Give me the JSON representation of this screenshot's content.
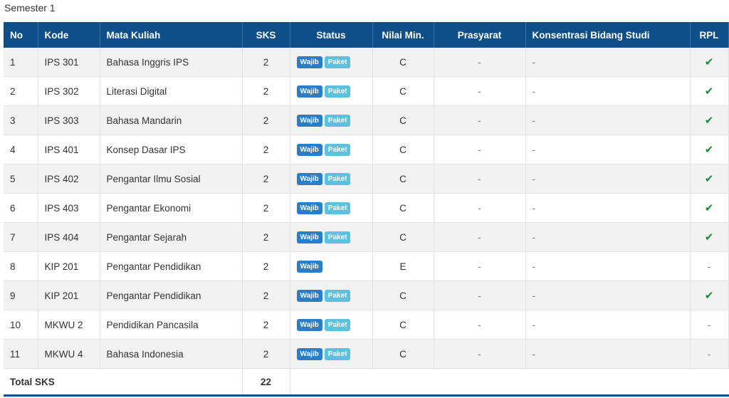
{
  "semester_title": "Semester 1",
  "colors": {
    "header_bg": "#0e4f8a",
    "badge_wajib": "#2c7dc8",
    "badge_paket": "#5cc0de",
    "check": "#1a8a3c"
  },
  "columns": {
    "no": "No",
    "kode": "Kode",
    "mata_kuliah": "Mata Kuliah",
    "sks": "SKS",
    "status": "Status",
    "nilai_min": "Nilai Min.",
    "prasyarat": "Prasyarat",
    "konsentrasi": "Konsentrasi Bidang Studi",
    "rpl": "RPL"
  },
  "badges": {
    "wajib": "Wajib",
    "paket": "Paket"
  },
  "rows": [
    {
      "no": "1",
      "kode": "IPS 301",
      "mata_kuliah": "Bahasa Inggris IPS",
      "sks": "2",
      "wajib": "Wajib",
      "paket": "Paket",
      "nilai_min": "C",
      "prasyarat": "-",
      "konsentrasi": "-",
      "rpl": "✔"
    },
    {
      "no": "2",
      "kode": "IPS 302",
      "mata_kuliah": "Literasi Digital",
      "sks": "2",
      "wajib": "Wajib",
      "paket": "Paket",
      "nilai_min": "C",
      "prasyarat": "-",
      "konsentrasi": "-",
      "rpl": "✔"
    },
    {
      "no": "3",
      "kode": "IPS 303",
      "mata_kuliah": "Bahasa Mandarin",
      "sks": "2",
      "wajib": "Wajib",
      "paket": "Paket",
      "nilai_min": "C",
      "prasyarat": "-",
      "konsentrasi": "-",
      "rpl": "✔"
    },
    {
      "no": "4",
      "kode": "IPS 401",
      "mata_kuliah": "Konsep Dasar IPS",
      "sks": "2",
      "wajib": "Wajib",
      "paket": "Paket",
      "nilai_min": "C",
      "prasyarat": "-",
      "konsentrasi": "-",
      "rpl": "✔"
    },
    {
      "no": "5",
      "kode": "IPS 402",
      "mata_kuliah": "Pengantar Ilmu Sosial",
      "sks": "2",
      "wajib": "Wajib",
      "paket": "Paket",
      "nilai_min": "C",
      "prasyarat": "-",
      "konsentrasi": "-",
      "rpl": "✔"
    },
    {
      "no": "6",
      "kode": "IPS 403",
      "mata_kuliah": "Pengantar Ekonomi",
      "sks": "2",
      "wajib": "Wajib",
      "paket": "Paket",
      "nilai_min": "C",
      "prasyarat": "-",
      "konsentrasi": "-",
      "rpl": "✔"
    },
    {
      "no": "7",
      "kode": "IPS 404",
      "mata_kuliah": "Pengantar Sejarah",
      "sks": "2",
      "wajib": "Wajib",
      "paket": "Paket",
      "nilai_min": "C",
      "prasyarat": "-",
      "konsentrasi": "-",
      "rpl": "✔"
    },
    {
      "no": "8",
      "kode": "KIP 201",
      "mata_kuliah": "Pengantar Pendidikan",
      "sks": "2",
      "wajib": "Wajib",
      "paket": null,
      "nilai_min": "E",
      "prasyarat": "-",
      "konsentrasi": "-",
      "rpl": "-"
    },
    {
      "no": "9",
      "kode": "KIP 201",
      "mata_kuliah": "Pengantar Pendidikan",
      "sks": "2",
      "wajib": "Wajib",
      "paket": "Paket",
      "nilai_min": "C",
      "prasyarat": "-",
      "konsentrasi": "-",
      "rpl": "✔"
    },
    {
      "no": "10",
      "kode": "MKWU 2",
      "mata_kuliah": "Pendidikan Pancasila",
      "sks": "2",
      "wajib": "Wajib",
      "paket": "Paket",
      "nilai_min": "C",
      "prasyarat": "-",
      "konsentrasi": "-",
      "rpl": "-"
    },
    {
      "no": "11",
      "kode": "MKWU 4",
      "mata_kuliah": "Bahasa Indonesia",
      "sks": "2",
      "wajib": "Wajib",
      "paket": "Paket",
      "nilai_min": "C",
      "prasyarat": "-",
      "konsentrasi": "-",
      "rpl": "-"
    }
  ],
  "total": {
    "label": "Total SKS",
    "value": "22"
  }
}
